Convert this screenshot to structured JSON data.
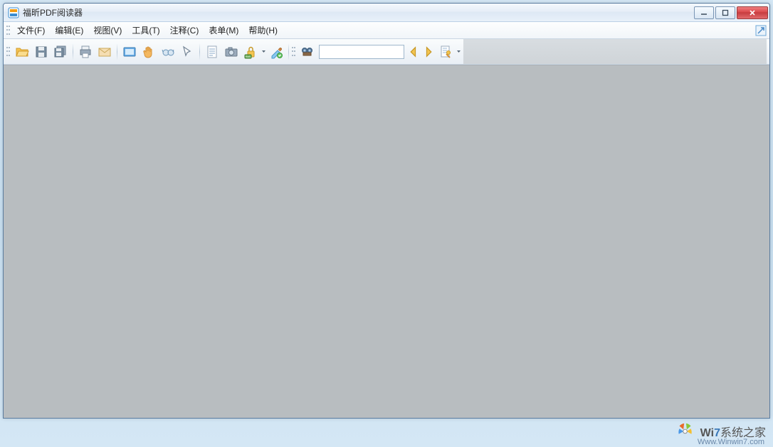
{
  "titlebar": {
    "title": "福昕PDF阅读器"
  },
  "menubar": {
    "items": [
      {
        "label": "文件(F)"
      },
      {
        "label": "编辑(E)"
      },
      {
        "label": "视图(V)"
      },
      {
        "label": "工具(T)"
      },
      {
        "label": "注释(C)"
      },
      {
        "label": "表单(M)"
      },
      {
        "label": "帮助(H)"
      }
    ]
  },
  "toolbar": {
    "icons": {
      "open": "open",
      "save": "save",
      "saveall": "save-multi",
      "print": "print",
      "email": "email",
      "screen": "screen",
      "hand": "hand",
      "glasses": "glasses",
      "select": "select",
      "text": "text-doc",
      "camera": "camera",
      "lock": "rms-lock",
      "brush": "brush",
      "binoc": "binoculars",
      "prev": "prev",
      "next": "next",
      "page": "page-mark"
    },
    "rms_label": "RMS",
    "search_value": ""
  },
  "watermark": {
    "brand_prefix": "Wi",
    "brand_seven": "7",
    "brand_cn": "系统之家",
    "url": "Www.Winwin7.com"
  }
}
